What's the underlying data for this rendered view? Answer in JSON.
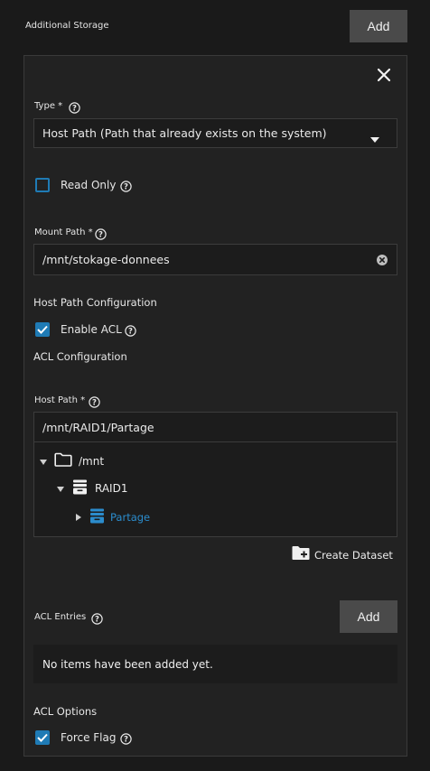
{
  "header": {
    "title": "Additional Storage",
    "add_label": "Add"
  },
  "type_field": {
    "label": "Type *",
    "value": "Host Path (Path that already exists on the system)"
  },
  "read_only": {
    "label": "Read Only"
  },
  "mount_path": {
    "label": "Mount Path *",
    "value": "/mnt/stokage-donnees"
  },
  "host_path_config": {
    "title": "Host Path Configuration"
  },
  "enable_acl": {
    "label": "Enable ACL"
  },
  "acl_config": {
    "title": "ACL Configuration"
  },
  "host_path": {
    "label": "Host Path *",
    "value": "/mnt/RAID1/Partage",
    "tree": [
      {
        "label": "/mnt"
      },
      {
        "label": "RAID1"
      },
      {
        "label": "Partage"
      }
    ]
  },
  "create_dataset": {
    "label": "Create Dataset"
  },
  "acl_entries": {
    "label": "ACL Entries",
    "add_label": "Add",
    "empty_text": "No items have been added yet."
  },
  "acl_options": {
    "title": "ACL Options"
  },
  "force_flag": {
    "label": "Force Flag"
  },
  "colors": {
    "accent": "#1f7bb5",
    "button": "#4a4a4a",
    "selected_text": "#2b8ccc"
  }
}
